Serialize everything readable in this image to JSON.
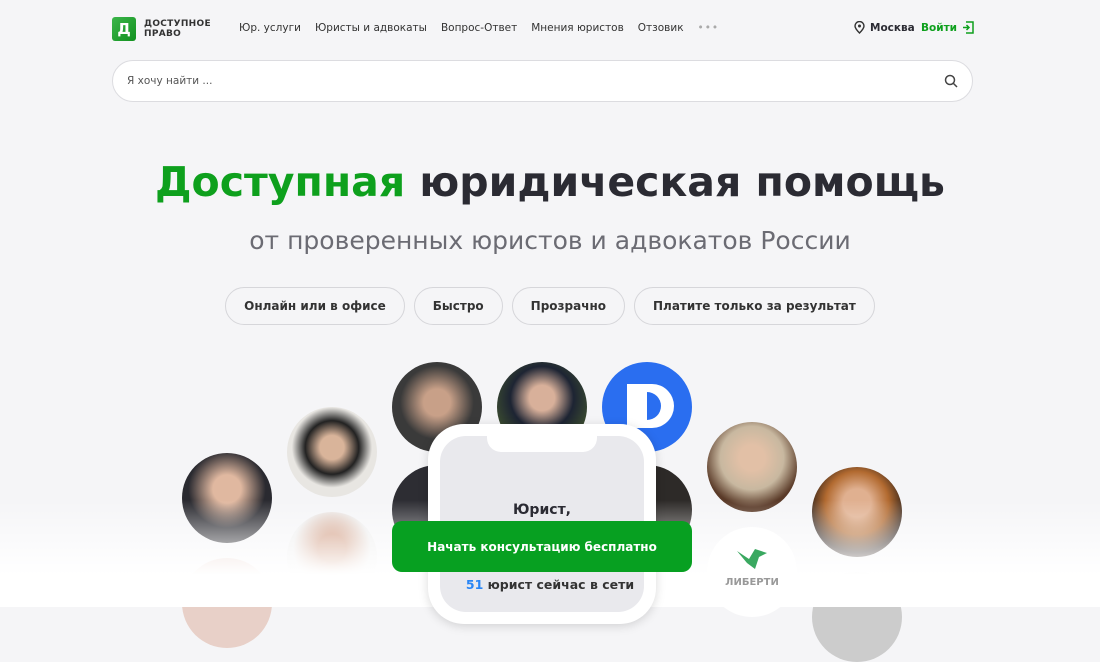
{
  "header": {
    "logo_line1": "ДОСТУПНОЕ",
    "logo_line2": "ПРАВО",
    "logo_letter": "Д",
    "nav": [
      "Юр. услуги",
      "Юристы и адвокаты",
      "Вопрос-Ответ",
      "Мнения юристов",
      "Отзовик"
    ],
    "more": "•••",
    "city": "Москва",
    "login": "Войти"
  },
  "search": {
    "placeholder": "Я хочу найти ..."
  },
  "hero": {
    "title_accent": "Доступная",
    "title_rest": " юридическая помощь",
    "subtitle": "от проверенных юристов и адвокатов России",
    "pills": [
      "Онлайн или в офисе",
      "Быстро",
      "Прозрачно",
      "Платите только за результат"
    ]
  },
  "phone": {
    "text": "Юрист,"
  },
  "cta": {
    "label": "Начать консультацию бесплатно"
  },
  "online": {
    "count": "51",
    "text": " юрист сейчас в сети"
  },
  "partner": {
    "name": "ЛИБЕРТИ"
  },
  "colors": {
    "accent": "#0ea01d",
    "link": "#2a86f5"
  }
}
